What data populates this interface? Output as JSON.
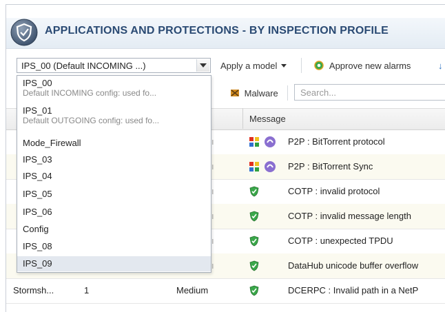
{
  "header": {
    "title": "APPLICATIONS AND PROTECTIONS - BY INSPECTION PROFILE"
  },
  "toolbar": {
    "profile_select_value": "IPS_00 (Default INCOMING ...)",
    "apply_model_label": "Apply a model",
    "approve_alarms_label": "Approve new alarms"
  },
  "filters": {
    "malware_label": "Malware",
    "search_placeholder": "Search..."
  },
  "table": {
    "message_header": "Message",
    "rows": [
      {
        "message": "P2P : BitTorrent protocol",
        "icon": "application-icon"
      },
      {
        "message": "P2P : BitTorrent Sync",
        "icon": "application-icon"
      },
      {
        "message": "COTP : invalid protocol",
        "icon": "protection-shield-icon"
      },
      {
        "message": "COTP : invalid message length",
        "icon": "protection-shield-icon"
      },
      {
        "message": "COTP : unexpected TPDU",
        "icon": "protection-shield-icon"
      },
      {
        "message": "DataHub unicode buffer overflow",
        "icon": "protection-shield-icon"
      },
      {
        "context": "Stormsh...",
        "count": "1",
        "level": "Medium",
        "message": "DCERPC : Invalid path in a NetP",
        "icon": "protection-shield-icon"
      }
    ]
  },
  "dropdown": {
    "options": [
      {
        "name": "IPS_00",
        "desc": "Default INCOMING config: used fo..."
      },
      {
        "name": "IPS_01",
        "desc": "Default OUTGOING config: used fo..."
      },
      {
        "name": "Mode_Firewall",
        "desc": ""
      },
      {
        "name": "IPS_03",
        "desc": ""
      },
      {
        "name": "IPS_04",
        "desc": ""
      },
      {
        "name": "IPS_05",
        "desc": ""
      },
      {
        "name": "IPS_06",
        "desc": ""
      },
      {
        "name": "Config",
        "desc": ""
      },
      {
        "name": "IPS_08",
        "desc": ""
      },
      {
        "name": "IPS_09",
        "desc": ""
      }
    ],
    "highlighted": "IPS_09"
  },
  "colors": {
    "title": "#2a4a73",
    "accent_green": "#3aa84a",
    "highlight": "#e3e8ef"
  }
}
